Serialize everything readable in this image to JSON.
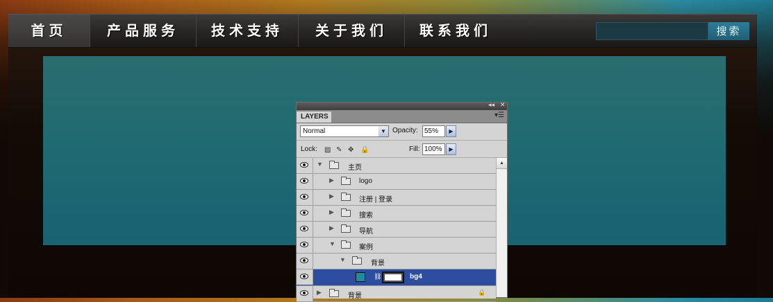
{
  "nav": {
    "items": [
      {
        "label": "首页",
        "active": true
      },
      {
        "label": "产品服务",
        "active": false
      },
      {
        "label": "技术支持",
        "active": false
      },
      {
        "label": "关于我们",
        "active": false
      },
      {
        "label": "联系我们",
        "active": false
      }
    ],
    "search": {
      "value": "",
      "button_label": "搜索"
    }
  },
  "layers_panel": {
    "title_controls": [
      "◂◂",
      "✕"
    ],
    "tab_label": "LAYERS",
    "tab_menu": "▾☰",
    "blend_mode": "Normal",
    "opacity_label": "Opacity:",
    "opacity_value": "55%",
    "lock_label": "Lock:",
    "fill_label": "Fill:",
    "fill_value": "100%",
    "layers": [
      {
        "name": "主页",
        "type": "group",
        "expanded": true,
        "depth": 0
      },
      {
        "name": "logo",
        "type": "group",
        "expanded": false,
        "depth": 1
      },
      {
        "name": "注册 | 登录",
        "type": "group",
        "expanded": false,
        "depth": 1
      },
      {
        "name": "搜索",
        "type": "group",
        "expanded": false,
        "depth": 1
      },
      {
        "name": "导航",
        "type": "group",
        "expanded": false,
        "depth": 1
      },
      {
        "name": "案例",
        "type": "group",
        "expanded": true,
        "depth": 1
      },
      {
        "name": "背景",
        "type": "group",
        "expanded": true,
        "depth": 2
      },
      {
        "name": "bg4",
        "type": "layer",
        "selected": true,
        "depth": 3
      },
      {
        "name": "背景",
        "type": "group",
        "expanded": false,
        "depth": 0,
        "locked": true
      }
    ]
  },
  "colors": {
    "selection": "#2d4ea0",
    "banner": "#1f6a72",
    "search_button": "#2d7d98"
  }
}
